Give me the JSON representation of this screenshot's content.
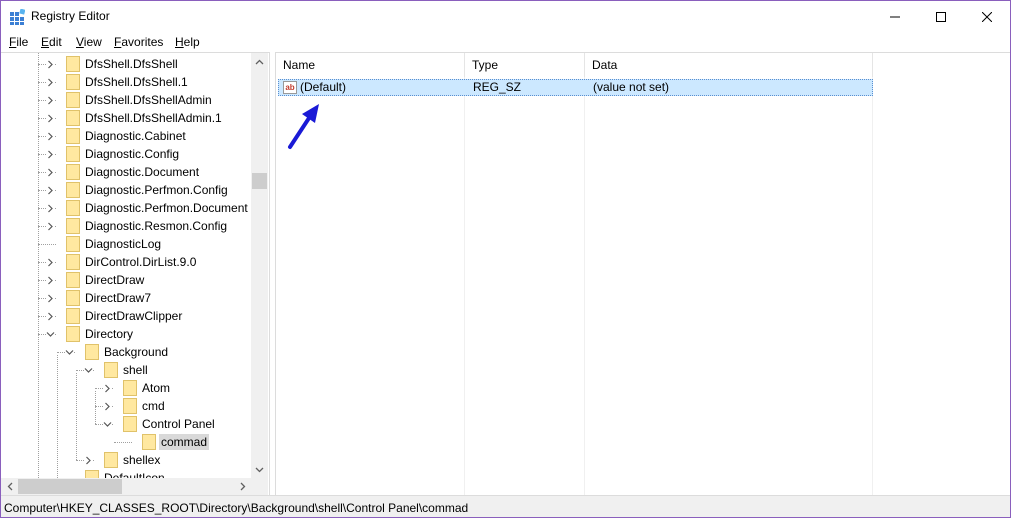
{
  "window": {
    "title": "Registry Editor"
  },
  "menu": [
    "File",
    "Edit",
    "View",
    "Favorites",
    "Help"
  ],
  "tree": {
    "items": [
      {
        "label": "DfsShell.DfsShell",
        "level": 2,
        "expandable": true
      },
      {
        "label": "DfsShell.DfsShell.1",
        "level": 2,
        "expandable": true
      },
      {
        "label": "DfsShell.DfsShellAdmin",
        "level": 2,
        "expandable": true
      },
      {
        "label": "DfsShell.DfsShellAdmin.1",
        "level": 2,
        "expandable": true
      },
      {
        "label": "Diagnostic.Cabinet",
        "level": 2,
        "expandable": true
      },
      {
        "label": "Diagnostic.Config",
        "level": 2,
        "expandable": true
      },
      {
        "label": "Diagnostic.Document",
        "level": 2,
        "expandable": true
      },
      {
        "label": "Diagnostic.Perfmon.Config",
        "level": 2,
        "expandable": true
      },
      {
        "label": "Diagnostic.Perfmon.Document",
        "level": 2,
        "expandable": true
      },
      {
        "label": "Diagnostic.Resmon.Config",
        "level": 2,
        "expandable": true
      },
      {
        "label": "DiagnosticLog",
        "level": 2,
        "expandable": false
      },
      {
        "label": "DirControl.DirList.9.0",
        "level": 2,
        "expandable": true
      },
      {
        "label": "DirectDraw",
        "level": 2,
        "expandable": true
      },
      {
        "label": "DirectDraw7",
        "level": 2,
        "expandable": true
      },
      {
        "label": "DirectDrawClipper",
        "level": 2,
        "expandable": true
      },
      {
        "label": "Directory",
        "level": 2,
        "expandable": true,
        "expanded": true
      },
      {
        "label": "Background",
        "level": 3,
        "expandable": true,
        "expanded": true
      },
      {
        "label": "shell",
        "level": 4,
        "expandable": true,
        "expanded": true
      },
      {
        "label": "Atom",
        "level": 5,
        "expandable": true
      },
      {
        "label": "cmd",
        "level": 5,
        "expandable": true
      },
      {
        "label": "Control Panel",
        "level": 5,
        "expandable": true,
        "expanded": true
      },
      {
        "label": "commad",
        "level": 6,
        "expandable": false,
        "selected": true
      },
      {
        "label": "shellex",
        "level": 4,
        "expandable": true
      },
      {
        "label": "DefaultIcon",
        "level": 3,
        "expandable": false
      }
    ]
  },
  "list": {
    "columns": [
      "Name",
      "Type",
      "Data"
    ],
    "rows": [
      {
        "icon": "string-value-icon",
        "icon_text": "ab",
        "name": "(Default)",
        "type": "REG_SZ",
        "data": "(value not set)"
      }
    ]
  },
  "status": {
    "path": "Computer\\HKEY_CLASSES_ROOT\\Directory\\Background\\shell\\Control Panel\\commad"
  },
  "colors": {
    "selection": "#cce8ff",
    "folder": "#ffe9a3",
    "arrow": "#1a1ad6",
    "border": "#8a5fbd"
  }
}
